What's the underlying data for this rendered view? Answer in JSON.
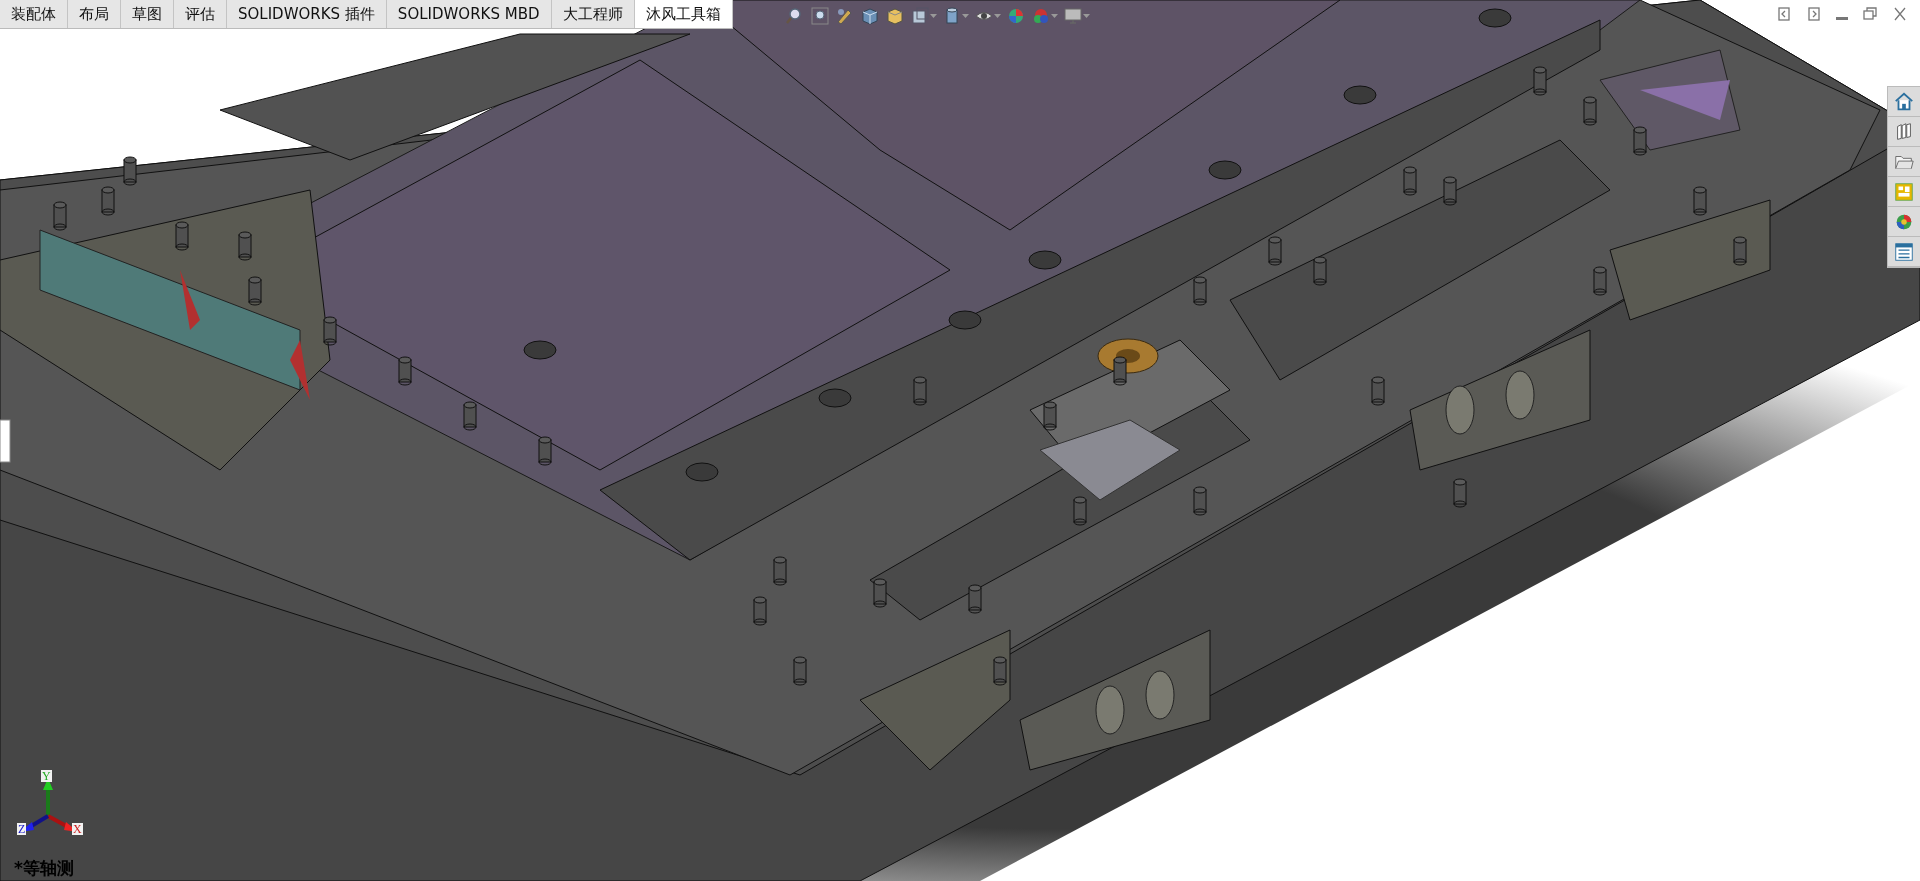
{
  "tabs": [
    {
      "label": "装配体",
      "selected": false
    },
    {
      "label": "布局",
      "selected": false
    },
    {
      "label": "草图",
      "selected": false
    },
    {
      "label": "评估",
      "selected": false
    },
    {
      "label": "SOLIDWORKS 插件",
      "selected": false
    },
    {
      "label": "SOLIDWORKS MBD",
      "selected": false
    },
    {
      "label": "大工程师",
      "selected": false
    },
    {
      "label": "沐风工具箱",
      "selected": true
    }
  ],
  "triad": {
    "x_label": "X",
    "y_label": "Y",
    "z_label": "Z"
  },
  "view_label": "*等轴测"
}
